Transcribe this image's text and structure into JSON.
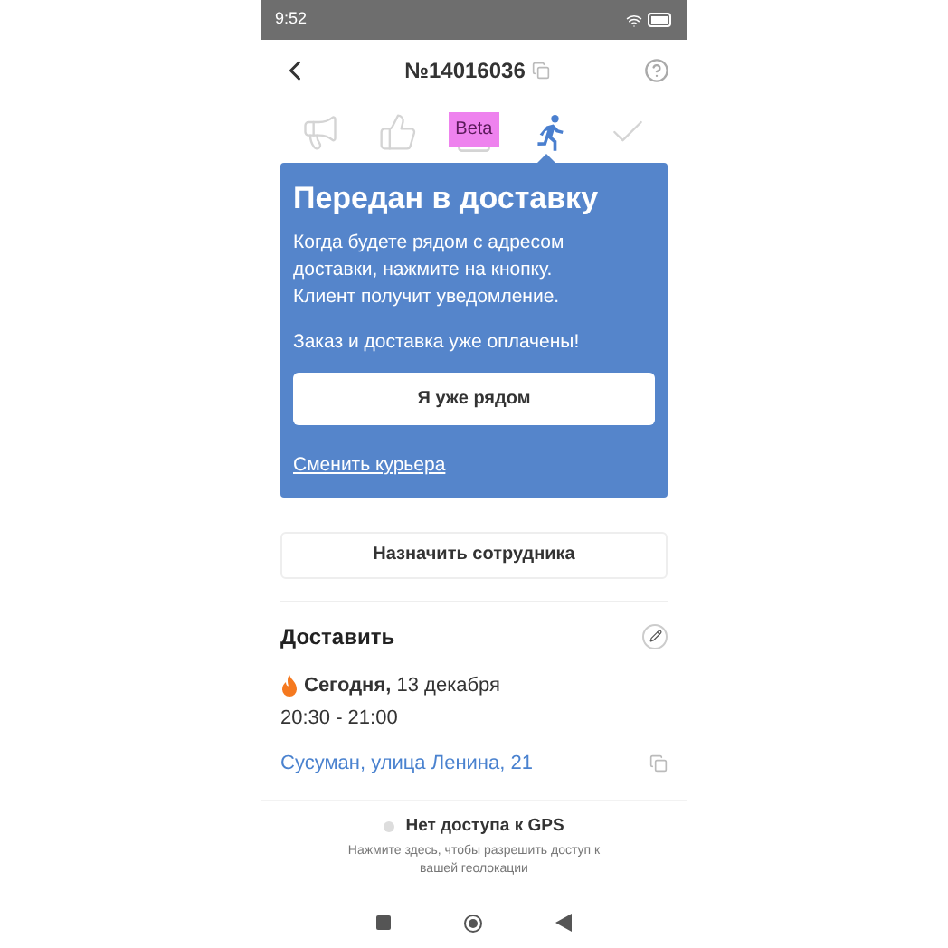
{
  "status_bar": {
    "time": "9:52"
  },
  "header": {
    "title": "№14016036"
  },
  "steps": [
    {
      "kind": "megaphone",
      "selected": false
    },
    {
      "kind": "thumb",
      "selected": false
    },
    {
      "kind": "box",
      "selected": false,
      "badge": "Beta"
    },
    {
      "kind": "runner",
      "selected": true
    },
    {
      "kind": "check",
      "selected": false
    }
  ],
  "card": {
    "title": "Передан в доставку",
    "text": "Когда будете рядом с адресом доставки, нажмите на кнопку. Клиент получит уведомление.",
    "note": "Заказ и доставка уже оплачены!",
    "button": "Я уже рядом",
    "link": "Сменить курьера"
  },
  "assign_button": "Назначить сотрудника",
  "delivery": {
    "heading": "Доставить",
    "date": "**Сегодня,** 13 декабря",
    "time": "20:30 - 21:00",
    "address": "Сусуман, улица Ленина, 21"
  },
  "gps": {
    "title": "Нет доступа к GPS",
    "hint": "Нажмите здесь, чтобы разрешить доступ к вашей геолокации"
  }
}
